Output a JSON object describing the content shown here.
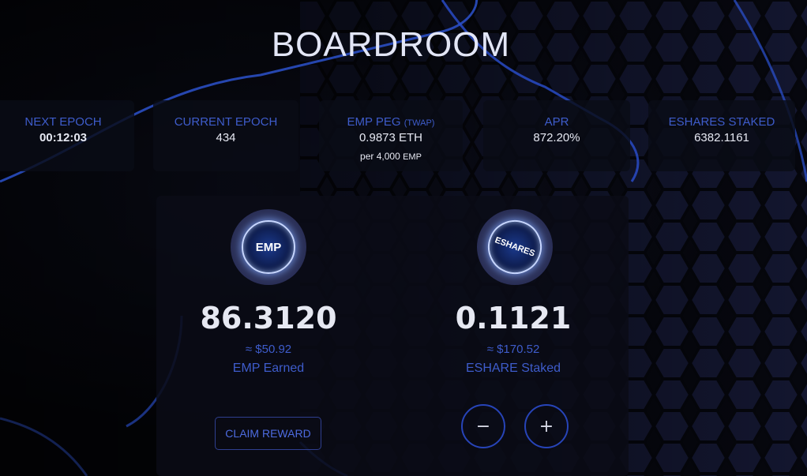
{
  "page": {
    "title": "BOARDROOM"
  },
  "stats": [
    {
      "label": "NEXT EPOCH",
      "value": "00:12:03"
    },
    {
      "label": "CURRENT EPOCH",
      "value": "434"
    },
    {
      "label_main": "EMP PEG ",
      "label_small": "(TWAP)",
      "value": "0.9873 ETH",
      "sub_main": "per 4,000 ",
      "sub_small": "EMP"
    },
    {
      "label": "APR",
      "value": "872.20%"
    },
    {
      "label": "ESHARES STAKED",
      "value": "6382.1161"
    }
  ],
  "earn_card": {
    "token_text": "EMP",
    "amount": "86.3120",
    "usd": "≈ $50.92",
    "caption": "EMP Earned",
    "button_label": "CLAIM REWARD"
  },
  "stake_card": {
    "token_text": "ESHARES",
    "amount": "0.1121",
    "usd": "≈ $170.52",
    "caption": "ESHARE Staked",
    "minus_label": "−",
    "plus_label": "+"
  },
  "colors": {
    "accent": "#3e5ccb",
    "panel": "#0a0c16",
    "token_bg": "#2a2f56"
  }
}
